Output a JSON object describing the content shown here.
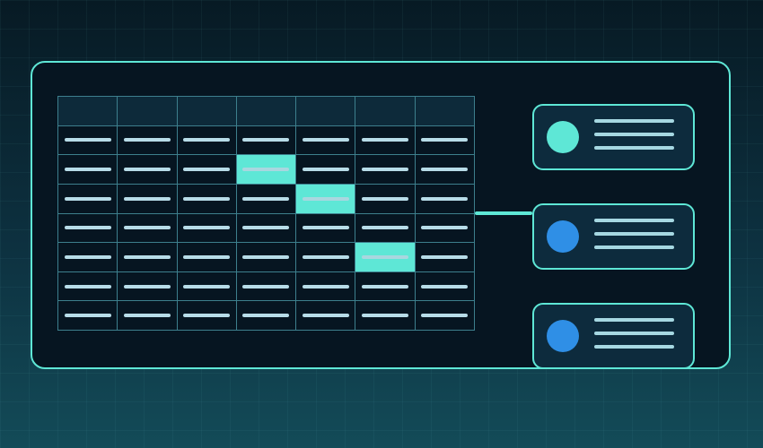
{
  "colors": {
    "background_top": "#071a24",
    "background_bottom": "#134b58",
    "accent": "#5ee7d6",
    "panel": "#061521",
    "card": "#0d2b3d",
    "grid_line": "#3d7f8d",
    "header_cell": "#0d2a3a",
    "text_placeholder": "#b7dce8",
    "avatar_primary": "#5ee7d6",
    "avatar_secondary": "#2f8fe6"
  },
  "grid": {
    "columns": 7,
    "rows": 8,
    "header_rows": 1,
    "highlighted_cells": [
      {
        "row": 2,
        "col": 3
      },
      {
        "row": 3,
        "col": 4
      },
      {
        "row": 5,
        "col": 5
      }
    ]
  },
  "cards": [
    {
      "avatar_color": "#5ee7d6",
      "lines": 3,
      "connected": false
    },
    {
      "avatar_color": "#2f8fe6",
      "lines": 3,
      "connected": true
    },
    {
      "avatar_color": "#2f8fe6",
      "lines": 3,
      "connected": false
    }
  ]
}
